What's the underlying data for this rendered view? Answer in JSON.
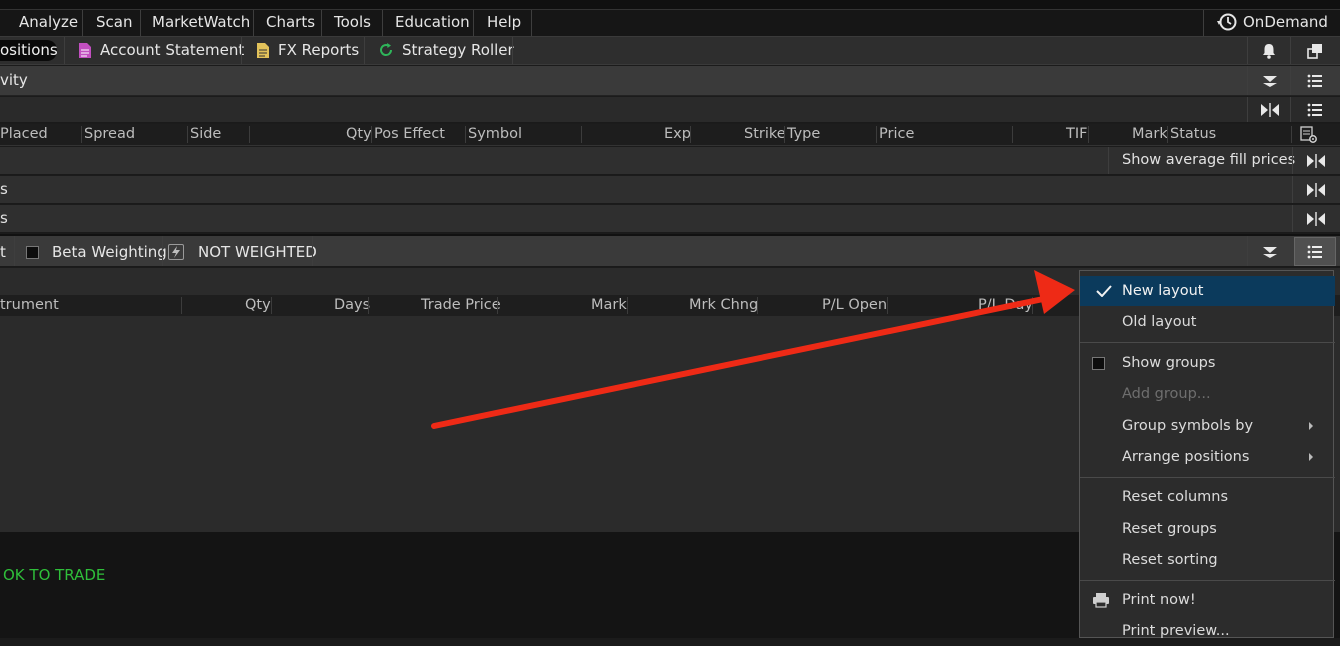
{
  "menubar": {
    "items": [
      "Analyze",
      "Scan",
      "MarketWatch",
      "Charts",
      "Tools",
      "Education",
      "Help"
    ],
    "ondemand": "OnDemand"
  },
  "subtabs": {
    "positions": "ositions",
    "account_statement": "Account Statement",
    "fx_reports": "FX Reports",
    "strategy_roller": "Strategy Roller"
  },
  "activity": {
    "label": "vity"
  },
  "orders": {
    "headers": {
      "placed": "Placed",
      "spread": "Spread",
      "side": "Side",
      "qty": "Qty",
      "pos_effect": "Pos Effect",
      "symbol": "Symbol",
      "exp": "Exp",
      "strike": "Strike",
      "type": "Type",
      "price": "Price",
      "tif": "TIF",
      "mark": "Mark",
      "status": "Status"
    },
    "fill_prices": "Show average fill prices",
    "section2": "s",
    "section3": "s"
  },
  "positions_bar": {
    "left": "t",
    "beta_weighting": "Beta Weighting",
    "not_weighted": "NOT WEIGHTED"
  },
  "positions_table": {
    "headers": {
      "instrument": "trument",
      "qty": "Qty",
      "days": "Days",
      "trade_price": "Trade Price",
      "mark": "Mark",
      "mrk_chng": "Mrk Chng",
      "pl_open": "P/L Open",
      "pl_day": "P/L Day"
    }
  },
  "status": {
    "ok_to_trade": "OK TO TRADE"
  },
  "context_menu": {
    "new_layout": "New layout",
    "old_layout": "Old layout",
    "show_groups": "Show groups",
    "add_group": "Add group...",
    "group_symbols_by": "Group symbols by",
    "arrange_positions": "Arrange positions",
    "reset_columns": "Reset columns",
    "reset_groups": "Reset groups",
    "reset_sorting": "Reset sorting",
    "print_now": "Print now!",
    "print_preview": "Print preview..."
  },
  "colors": {
    "menu_selected": "#0b3a5c",
    "ok_green": "#2fbf3a",
    "arrow_red": "#ee2a16"
  }
}
